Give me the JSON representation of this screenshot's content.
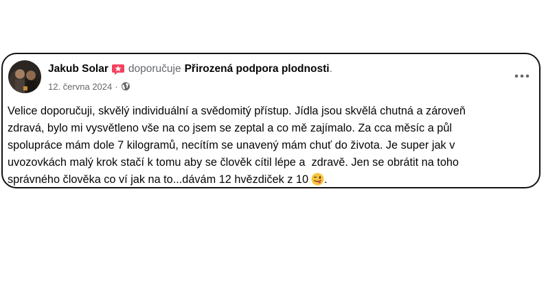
{
  "post": {
    "author": "Jakub Solar",
    "action": "doporučuje",
    "page_name": "Přirozená podpora plodnosti",
    "trailing_dot": ".",
    "date": "12. června 2024",
    "meta_separator": "·",
    "text": "Velice doporučuji, skvělý individuální a svědomitý přístup. Jídla jsou skvělá chutná a zároveň\nzdravá, bylo mi vysvětleno vše na co jsem se zeptal a co mě zajímalo. Za cca měsíc a půl\nspolupráce mám dole 7 kilogramů, necítím se unavený mám chuť do života. Je super jak v\nuvozovkách malý krok stačí k tomu aby se člověk cítil lépe a  zdravě. Jen se obrátit na toho\nsprávného člověka co ví jak na to...dávám 12 hvězdiček z 10",
    "text_end": ".",
    "icons": {
      "recommend_badge": "recommend-star-icon",
      "privacy": "globe-icon",
      "more": "more-options-icon",
      "emoji": "winking-tongue-emoji-icon"
    },
    "colors": {
      "badge": "#f3425f",
      "meta_gray": "#65676b",
      "text": "#050505",
      "emoji_face": "#f7c53b"
    }
  }
}
